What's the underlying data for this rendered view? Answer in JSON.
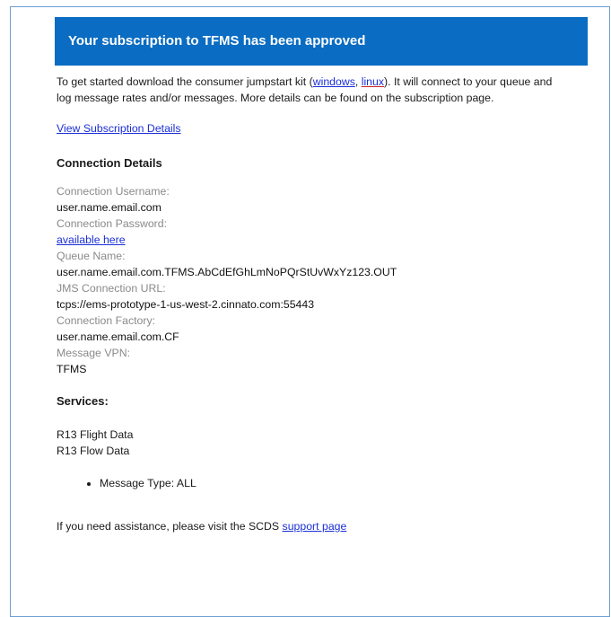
{
  "banner": {
    "title": "Your subscription to TFMS has been approved"
  },
  "intro": {
    "text_before": "To get started download the consumer jumpstart kit (",
    "windows_link": "windows",
    "separator": ", ",
    "linux_link": "linux",
    "text_after": "). It will connect to your queue and log message rates and/or messages. More details can be found on the subscription page."
  },
  "view_details_link": "View Subscription Details",
  "connection": {
    "heading": "Connection Details",
    "fields": [
      {
        "label": "Connection Username:",
        "value": "user.name.email.com"
      },
      {
        "label": "Connection Password:",
        "value": "available here"
      },
      {
        "label": "Queue Name:",
        "value": "user.name.email.com.TFMS.AbCdEfGhLmNoPQrStUvWxYz123.OUT"
      },
      {
        "label": "JMS Connection URL:",
        "value": "tcps://ems-prototype-1-us-west-2.cinnato.com:55443"
      },
      {
        "label": "Connection Factory:",
        "value": "user.name.email.com.CF"
      },
      {
        "label": "Message VPN:",
        "value": "TFMS"
      }
    ]
  },
  "services": {
    "heading": "Services:",
    "items": [
      "R13 Flight Data",
      "R13 Flow Data"
    ],
    "bullets": [
      "Message Type: ALL"
    ]
  },
  "footer": {
    "text": "If you need assistance, please visit the SCDS ",
    "link": "support page"
  }
}
